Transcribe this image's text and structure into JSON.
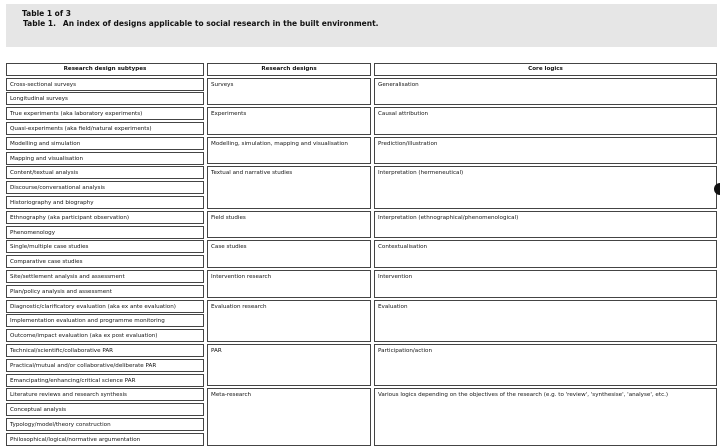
{
  "caption": {
    "counter": "Table 1 of 3",
    "label": "Table 1.",
    "title": "An index of designs applicable to social research in the built environment."
  },
  "table": {
    "headers": [
      "Research design subtypes",
      "Research designs",
      "Core logics"
    ],
    "subtypes": [
      "Cross-sectional surveys",
      "Longitudinal surveys",
      "True experiments (aka laboratory experiments)",
      "Quasi-experiments (aka field/natural experiments)",
      "Modelling and simulation",
      "Mapping and visualisation",
      "Content/textual analysis",
      "Discourse/conversational analysis",
      "Historiography and biography",
      "Ethnography (aka participant observation)",
      "Phenomenology",
      "Single/multiple case studies",
      "Comparative case studies",
      "Site/settlement analysis and assessment",
      "Plan/policy analysis and assessment",
      "Diagnostic/clarificatory evaluation (aka ex ante evaluation)",
      "Implementation evaluation and programme monitoring",
      "Outcome/impact evaluation (aka ex post evaluation)",
      "Technical/scientific/collaborative PAR",
      "Practical/mutual and/or collaborative/deliberate PAR",
      "Emancipating/enhancing/critical science PAR",
      "Literature reviews and research synthesis",
      "Conceptual analysis",
      "Typology/model/theory construction",
      "Philosophical/logical/normative argumentation"
    ],
    "groups": [
      {
        "design": "Surveys",
        "logic": "Generalisation"
      },
      {
        "design": "Experiments",
        "logic": "Causal attribution"
      },
      {
        "design": "Modelling, simulation, mapping and visualisation",
        "logic": "Prediction/illustration"
      },
      {
        "design": "Textual and narrative studies",
        "logic": "Interpretation (hermeneutical)"
      },
      {
        "design": "Field studies",
        "logic": "Interpretation (ethnographical/phenomenological)"
      },
      {
        "design": "Case studies",
        "logic": "Contextualisation"
      },
      {
        "design": "Intervention research",
        "logic": "Intervention"
      },
      {
        "design": "Evaluation research",
        "logic": "Evaluation"
      },
      {
        "design": "PAR",
        "logic": "Participation/action"
      },
      {
        "design": "Meta-research",
        "logic": "Various logics depending on the objectives of the research (e.g. to 'review', 'synthesise', 'analyse', etc.)"
      }
    ]
  }
}
